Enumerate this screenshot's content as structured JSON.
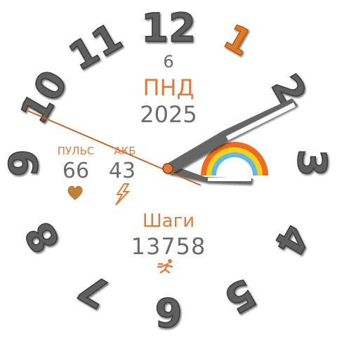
{
  "dial": {
    "numerals": [
      "12",
      "1",
      "2",
      "3",
      "4",
      "5",
      "6",
      "7",
      "8",
      "9",
      "10",
      "11"
    ],
    "highlight_numeral": "1",
    "colors": {
      "numeral": "#5f5f5f",
      "highlight": "#e07a26",
      "accent": "#e27a3a",
      "text": "#6b6b6b"
    }
  },
  "date": {
    "day": "6",
    "weekday": "ПНД",
    "year": "2025"
  },
  "pulse": {
    "label": "ПУЛЬС",
    "value": "66",
    "icon": "heart-icon"
  },
  "ake": {
    "label": "АКБ",
    "value": "43",
    "icon": "lightning-icon"
  },
  "steps": {
    "label": "Шаги",
    "value": "13758",
    "icon": "runner-icon"
  },
  "weather_icon": "rainbow-icon"
}
